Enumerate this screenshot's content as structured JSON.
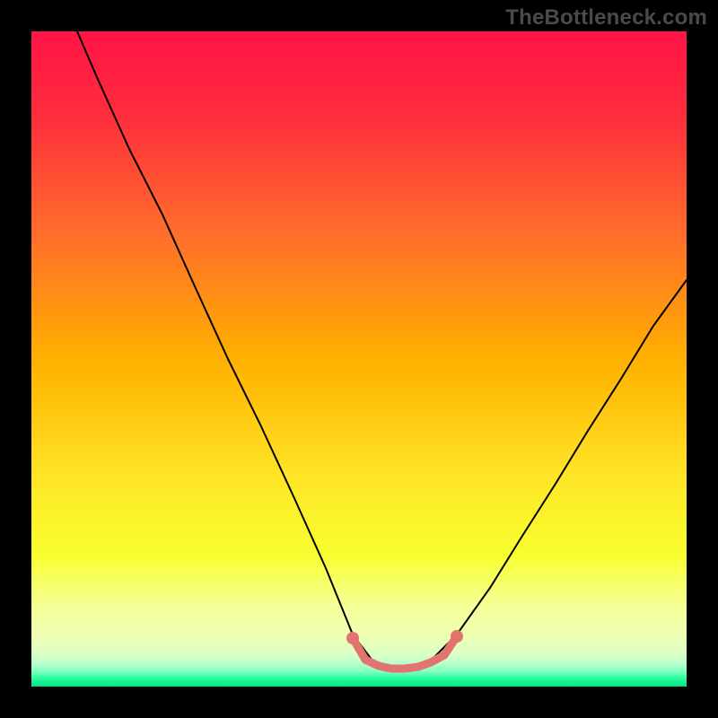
{
  "watermark": "TheBottleneck.com",
  "chart_data": {
    "type": "line",
    "title": "",
    "xlabel": "",
    "ylabel": "",
    "xlim": [
      0,
      100
    ],
    "ylim": [
      0,
      100
    ],
    "series": [
      {
        "name": "bottleneck-curve",
        "x": [
          7,
          10,
          15,
          20,
          25,
          30,
          35,
          40,
          45,
          49,
          52,
          55,
          58,
          61,
          65,
          70,
          75,
          80,
          85,
          90,
          95,
          100
        ],
        "y": [
          100,
          93,
          82,
          72,
          61,
          50,
          40,
          29,
          18,
          8,
          4,
          3,
          3,
          4,
          8,
          15,
          23,
          31,
          39,
          47,
          55,
          62
        ]
      },
      {
        "name": "optimal-zone-marker",
        "x": [
          49,
          51,
          53,
          55,
          57,
          59,
          61,
          63,
          65
        ],
        "y": [
          7,
          4,
          3,
          3,
          3,
          3,
          4,
          5,
          8
        ]
      }
    ],
    "background_gradient": {
      "stops": [
        {
          "pos": 0.0,
          "note": "top = 100% bottleneck",
          "color": "#ff1445"
        },
        {
          "pos": 0.5,
          "color": "#ffb000"
        },
        {
          "pos": 0.8,
          "color": "#f7ff30"
        },
        {
          "pos": 0.92,
          "color": "#efffb0"
        },
        {
          "pos": 0.96,
          "color": "#b8ffcc"
        },
        {
          "pos": 0.985,
          "color": "#2fff9e"
        },
        {
          "pos": 1.0,
          "note": "bottom = 0% bottleneck",
          "color": "#00e383"
        }
      ]
    },
    "curve_color": "#000000",
    "marker_color": "#E1746F"
  }
}
